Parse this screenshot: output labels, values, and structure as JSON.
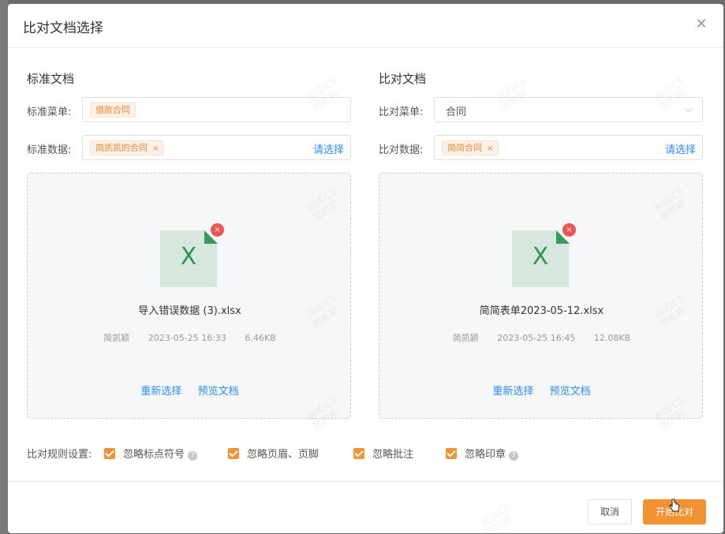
{
  "dialog": {
    "title": "比对文档选择",
    "close_icon": "close-icon"
  },
  "standard": {
    "heading": "标准文档",
    "menu_label": "标准菜单:",
    "menu_tag": "借款合同",
    "data_label": "标准数据:",
    "data_tag": "简凯凯的合同",
    "data_tag_remove": "×",
    "pick_link": "请选择",
    "file": {
      "icon_letter": "X",
      "remove": "×",
      "name": "导入错误数据 (3).xlsx",
      "author": "简凯颖",
      "time": "2023-05-25 16:33",
      "size": "6.46KB"
    },
    "reselect": "重新选择",
    "preview": "预览文档"
  },
  "compare": {
    "heading": "比对文档",
    "menu_label": "比对菜单:",
    "menu_value": "合同",
    "data_label": "比对数据:",
    "data_tag": "简简合同",
    "data_tag_remove": "×",
    "pick_link": "请选择",
    "file": {
      "icon_letter": "X",
      "remove": "×",
      "name": "简简表单2023-05-12.xlsx",
      "author": "简凯颖",
      "time": "2023-05-25 16:45",
      "size": "12.08KB"
    },
    "reselect": "重新选择",
    "preview": "预览文档"
  },
  "rules": {
    "label": "比对规则设置:",
    "items": [
      {
        "label": "忽略标点符号",
        "checked": true,
        "help": true
      },
      {
        "label": "忽略页眉、页脚",
        "checked": true,
        "help": false
      },
      {
        "label": "忽略批注",
        "checked": true,
        "help": false
      },
      {
        "label": "忽略印章",
        "checked": true,
        "help": true
      }
    ]
  },
  "footer": {
    "cancel": "取消",
    "start": "开始比对"
  },
  "watermark": {
    "line1": "测试iC5",
    "line2": "简凯颖"
  },
  "colors": {
    "accent": "#f39232",
    "link": "#2d8cf0",
    "excel_green": "#2e9456",
    "remove_red": "#f05454"
  }
}
